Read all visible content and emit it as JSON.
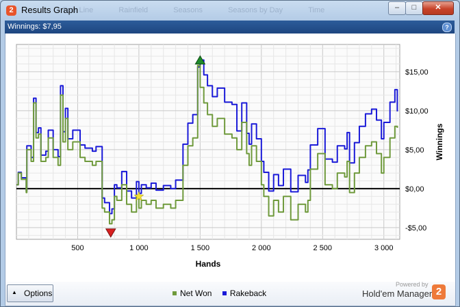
{
  "window": {
    "title": "Results Graph",
    "app_icon": "2",
    "background_tabs": [
      "Tour Line",
      "Rainfield",
      "Seasons",
      "Seasons by Day",
      "Time"
    ],
    "controls": {
      "minimize": "–",
      "maximize": "□",
      "close": "✕"
    }
  },
  "info": {
    "winnings_label": "Winnings: $7,95",
    "help": "?"
  },
  "chart_data": {
    "type": "line",
    "xlabel": "Hands",
    "ylabel": "Winnings",
    "xlim": [
      0,
      3130
    ],
    "ylim": [
      -6.5,
      18.5
    ],
    "x_ticks": [
      500,
      1000,
      1500,
      2000,
      2500,
      3000
    ],
    "x_tick_labels": [
      "500",
      "1 000",
      "1 500",
      "2 000",
      "2 500",
      "3 000"
    ],
    "y_ticks": [
      -5,
      0,
      5,
      10,
      15
    ],
    "y_tick_labels": [
      "-$5,00",
      "$0,00",
      "$5,00",
      "$10,00",
      "$15,00"
    ],
    "grid": true,
    "legend_position": "bottom",
    "series": [
      {
        "name": "Net Won",
        "color": "#6f9a3c",
        "x": [
          0,
          15,
          40,
          80,
          85,
          120,
          140,
          160,
          180,
          200,
          240,
          260,
          300,
          340,
          360,
          380,
          400,
          420,
          460,
          520,
          560,
          620,
          650,
          700,
          720,
          760,
          780,
          800,
          820,
          860,
          900,
          940,
          980,
          1000,
          1020,
          1060,
          1100,
          1140,
          1200,
          1260,
          1300,
          1360,
          1400,
          1440,
          1480,
          1500,
          1530,
          1560,
          1600,
          1640,
          1700,
          1760,
          1800,
          1840,
          1880,
          1900,
          1920,
          1960,
          2000,
          2020,
          2060,
          2100,
          2140,
          2180,
          2240,
          2300,
          2360,
          2380,
          2400,
          2460,
          2520,
          2580,
          2620,
          2680,
          2700,
          2720,
          2760,
          2800,
          2850,
          2900,
          2940,
          2980,
          3000,
          3050,
          3090,
          3110
        ],
        "y": [
          0.5,
          2.0,
          1.2,
          -0.5,
          5.0,
          3.5,
          11.0,
          6.5,
          7.0,
          3.5,
          4.0,
          6.5,
          4.0,
          3.0,
          12.0,
          6.0,
          9.0,
          5.0,
          6.0,
          4.0,
          3.5,
          3.0,
          3.5,
          -2.5,
          -3.0,
          -4.5,
          -4.0,
          -1.0,
          -1.5,
          0.5,
          -2.0,
          -3.0,
          -1.0,
          -2.5,
          -1.5,
          -2.0,
          -1.5,
          -2.5,
          -2.0,
          -2.5,
          -1.5,
          3.0,
          5.5,
          6.5,
          15.8,
          13.0,
          11.0,
          9.5,
          8.0,
          9.0,
          7.0,
          6.5,
          5.0,
          8.5,
          4.5,
          3.0,
          5.5,
          3.5,
          0.5,
          -1.0,
          -3.5,
          -1.5,
          -3.0,
          -1.0,
          -4.0,
          -2.0,
          -3.0,
          -1.5,
          2.5,
          4.5,
          0.5,
          0.0,
          2.0,
          1.5,
          3.5,
          -0.5,
          2.0,
          4.0,
          5.5,
          6.0,
          4.5,
          2.0,
          4.0,
          6.5,
          8.0,
          7.8
        ]
      },
      {
        "name": "Rakeback",
        "color": "#1a1ad8",
        "x": [
          0,
          15,
          40,
          80,
          85,
          120,
          140,
          160,
          180,
          200,
          240,
          260,
          300,
          340,
          360,
          380,
          400,
          420,
          460,
          520,
          560,
          620,
          650,
          700,
          720,
          760,
          780,
          800,
          820,
          860,
          900,
          940,
          980,
          1000,
          1020,
          1060,
          1100,
          1140,
          1200,
          1260,
          1300,
          1360,
          1400,
          1440,
          1480,
          1500,
          1530,
          1560,
          1600,
          1640,
          1700,
          1760,
          1800,
          1840,
          1880,
          1900,
          1920,
          1960,
          2000,
          2020,
          2060,
          2100,
          2140,
          2180,
          2240,
          2300,
          2360,
          2380,
          2400,
          2460,
          2520,
          2580,
          2620,
          2680,
          2700,
          2720,
          2760,
          2800,
          2850,
          2900,
          2940,
          2980,
          3000,
          3050,
          3090,
          3110
        ],
        "y": [
          0.5,
          2.1,
          1.4,
          -0.3,
          5.5,
          4.0,
          11.6,
          7.2,
          7.8,
          4.3,
          4.8,
          7.5,
          5.0,
          4.1,
          13.2,
          7.3,
          10.3,
          6.4,
          7.5,
          5.6,
          5.2,
          4.8,
          5.4,
          -1.2,
          -1.8,
          -3.2,
          -2.6,
          0.5,
          0.1,
          2.2,
          -0.3,
          -1.2,
          0.9,
          -0.6,
          0.5,
          0.1,
          0.7,
          -0.2,
          0.4,
          0.0,
          1.1,
          5.7,
          8.4,
          9.5,
          15.6,
          16.5,
          14.6,
          13.2,
          11.8,
          12.9,
          11.1,
          10.8,
          7.4,
          11.0,
          7.1,
          5.7,
          8.3,
          6.4,
          3.5,
          2.1,
          -0.3,
          1.8,
          0.4,
          2.5,
          -0.4,
          1.7,
          0.8,
          2.4,
          5.6,
          7.7,
          3.8,
          3.4,
          5.5,
          5.1,
          7.2,
          3.3,
          5.9,
          8.0,
          9.6,
          10.2,
          8.8,
          6.4,
          8.5,
          11.1,
          12.7,
          9.9
        ]
      }
    ],
    "markers": [
      {
        "name": "max",
        "x": 1500,
        "y": 15.8,
        "color": "#1f8a2a"
      },
      {
        "name": "min",
        "x": 770,
        "y": -4.9,
        "color": "#d82020"
      },
      {
        "name": "star",
        "x": 1000,
        "y": -1.0,
        "color": "#f2e03a"
      }
    ]
  },
  "footer": {
    "options_label": "Options",
    "legend": [
      {
        "label": "Net Won",
        "color": "#6f9a3c"
      },
      {
        "label": "Rakeback",
        "color": "#1a1ad8"
      }
    ],
    "powered_by": "Powered by",
    "brand": "Hold'em Manager",
    "brand_logo": "2"
  }
}
